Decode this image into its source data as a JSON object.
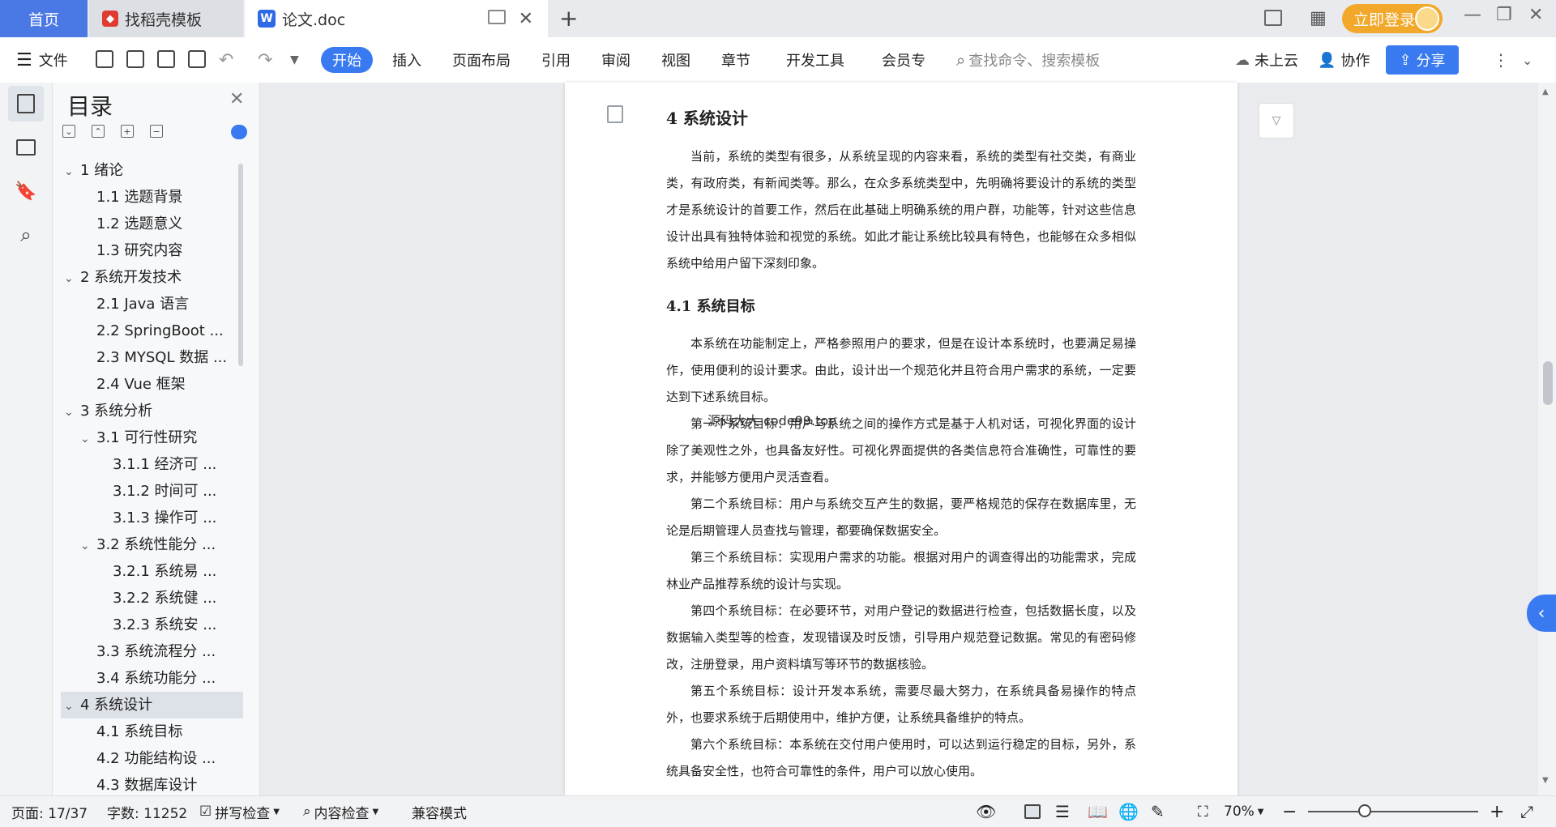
{
  "tabs": {
    "home": "首页",
    "templates": "找稻壳模板",
    "document": "论文.doc",
    "login": "立即登录"
  },
  "ribbon": {
    "file": "文件",
    "menus": [
      "开始",
      "插入",
      "页面布局",
      "引用",
      "审阅",
      "视图",
      "章节",
      "开发工具",
      "会员专"
    ],
    "search_placeholder": "查找命令、搜索模板",
    "cloud": "未上云",
    "collaborate": "协作",
    "share": "分享"
  },
  "toc": {
    "title": "目录",
    "items": [
      {
        "label": "1  绪论",
        "level": 1,
        "expanded": true
      },
      {
        "label": "1.1  选题背景",
        "level": 2
      },
      {
        "label": "1.2  选题意义",
        "level": 2
      },
      {
        "label": "1.3  研究内容",
        "level": 2
      },
      {
        "label": "2  系统开发技术",
        "level": 1,
        "expanded": true
      },
      {
        "label": "2.1 Java 语言",
        "level": 2
      },
      {
        "label": "2.2 SpringBoot ...",
        "level": 2
      },
      {
        "label": "2.3 MYSQL 数据 ...",
        "level": 2
      },
      {
        "label": "2.4 Vue 框架",
        "level": 2
      },
      {
        "label": "3  系统分析",
        "level": 1,
        "expanded": true
      },
      {
        "label": "3.1 可行性研究",
        "level": 2,
        "expanded": true
      },
      {
        "label": "3.1.1 经济可 ...",
        "level": 3
      },
      {
        "label": "3.1.2 时间可 ...",
        "level": 3
      },
      {
        "label": "3.1.3 操作可 ...",
        "level": 3
      },
      {
        "label": "3.2 系统性能分 ...",
        "level": 2,
        "expanded": true
      },
      {
        "label": "3.2.1 系统易 ...",
        "level": 3
      },
      {
        "label": "3.2.2 系统健 ...",
        "level": 3
      },
      {
        "label": "3.2.3 系统安 ...",
        "level": 3
      },
      {
        "label": "3.3  系统流程分 ...",
        "level": 2
      },
      {
        "label": "3.4 系统功能分 ...",
        "level": 2
      },
      {
        "label": "4  系统设计",
        "level": 1,
        "expanded": true,
        "active": true
      },
      {
        "label": "4.1 系统目标",
        "level": 2
      },
      {
        "label": "4.2 功能结构设 ...",
        "level": 2
      },
      {
        "label": "4.3 数据库设计",
        "level": 2
      }
    ]
  },
  "document": {
    "heading": "4  系统设计",
    "intro": "当前，系统的类型有很多，从系统呈现的内容来看，系统的类型有社交类，有商业类，有政府类，有新闻类等。那么，在众多系统类型中，先明确将要设计的系统的类型才是系统设计的首要工作，然后在此基础上明确系统的用户群，功能等，针对这些信息设计出具有独特体验和视觉的系统。如此才能让系统比较具有特色，也能够在众多相似系统中给用户留下深刻印象。",
    "subheading": "4.1 系统目标",
    "paragraphs": [
      "本系统在功能制定上，严格参照用户的要求，但是在设计本系统时，也要满足易操作，使用便利的设计要求。由此，设计出一个规范化并且符合用户需求的系统，一定要达到下述系统目标。",
      "第一个系统目标：用户与系统之间的操作方式是基于人机对话，可视化界面的设计除了美观性之外，也具备友好性。可视化界面提供的各类信息符合准确性，可靠性的要求，并能够方便用户灵活查看。",
      "第二个系统目标：用户与系统交互产生的数据，要严格规范的保存在数据库里，无论是后期管理人员查找与管理，都要确保数据安全。",
      "第三个系统目标：实现用户需求的功能。根据对用户的调查得出的功能需求，完成林业产品推荐系统的设计与实现。",
      "第四个系统目标：在必要环节，对用户登记的数据进行检查，包括数据长度，以及数据输入类型等的检查，发现错误及时反馈，引导用户规范登记数据。常见的有密码修改，注册登录，用户资料填写等环节的数据核验。",
      "第五个系统目标：设计开发本系统，需要尽最大努力，在系统具备易操作的特点外，也要求系统于后期使用中，维护方便，让系统具备维护的特点。",
      "第六个系统目标：本系统在交付用户使用时，可以达到运行稳定的目标，另外，系统具备安全性，也符合可靠性的条件，用户可以放心使用。"
    ],
    "stamp": "源码大大 code99.top"
  },
  "status": {
    "page": "页面: 17/37",
    "words": "字数: 11252",
    "spellcheck": "拼写检查",
    "content_check": "内容检查",
    "compat": "兼容模式",
    "zoom": "70%"
  },
  "colors": {
    "accent": "#3a7af0",
    "login": "#f2a82a",
    "home_tab": "#4a79e6"
  }
}
